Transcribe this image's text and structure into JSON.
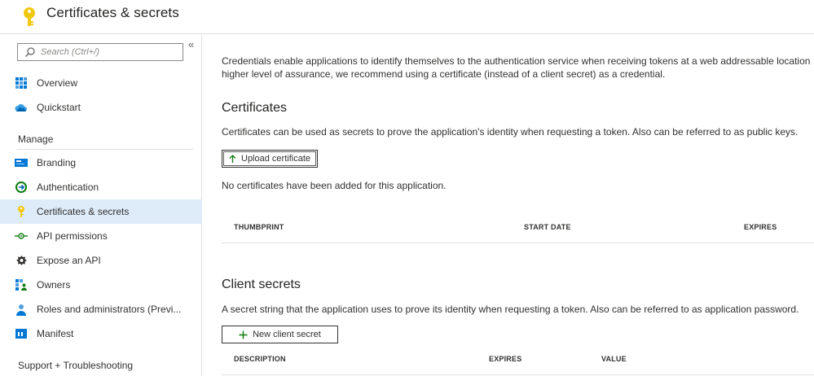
{
  "header": {
    "title": "Certificates & secrets",
    "icon": "key-icon"
  },
  "sidebar": {
    "search_placeholder": "Search (Ctrl+/)",
    "collapse_glyph": "«",
    "top_items": [
      {
        "label": "Overview",
        "icon": "overview-grid-icon"
      },
      {
        "label": "Quickstart",
        "icon": "quickstart-cloud-icon"
      }
    ],
    "manage_label": "Manage",
    "manage_items": [
      {
        "label": "Branding",
        "icon": "branding-icon"
      },
      {
        "label": "Authentication",
        "icon": "authentication-icon"
      },
      {
        "label": "Certificates & secrets",
        "icon": "key-icon",
        "active": true
      },
      {
        "label": "API permissions",
        "icon": "api-permissions-icon"
      },
      {
        "label": "Expose an API",
        "icon": "expose-api-icon"
      },
      {
        "label": "Owners",
        "icon": "owners-icon"
      },
      {
        "label": "Roles and administrators (Previ...",
        "icon": "roles-icon"
      },
      {
        "label": "Manifest",
        "icon": "manifest-icon"
      }
    ],
    "support_label": "Support + Troubleshooting"
  },
  "main": {
    "intro_line1": "Credentials enable applications to identify themselves to the authentication service when receiving tokens at a web addressable location",
    "intro_line2": "higher level of assurance, we recommend using a certificate (instead of a client secret) as a credential.",
    "certificates": {
      "title": "Certificates",
      "description": "Certificates can be used as secrets to prove the application's identity when requesting a token. Also can be referred to as public keys.",
      "upload_label": "Upload certificate",
      "empty_text": "No certificates have been added for this application.",
      "columns": [
        "THUMBPRINT",
        "START DATE",
        "EXPIRES"
      ]
    },
    "secrets": {
      "title": "Client secrets",
      "description": "A secret string that the application uses to prove its identity when requesting a token. Also can be referred to as application password.",
      "new_label": "New client secret",
      "columns": [
        "DESCRIPTION",
        "EXPIRES",
        "VALUE"
      ]
    }
  },
  "colors": {
    "accent": "#0078d4",
    "active_bg": "#deecf9",
    "key_yellow": "#f2c80f",
    "green_plus": "#107c10"
  }
}
